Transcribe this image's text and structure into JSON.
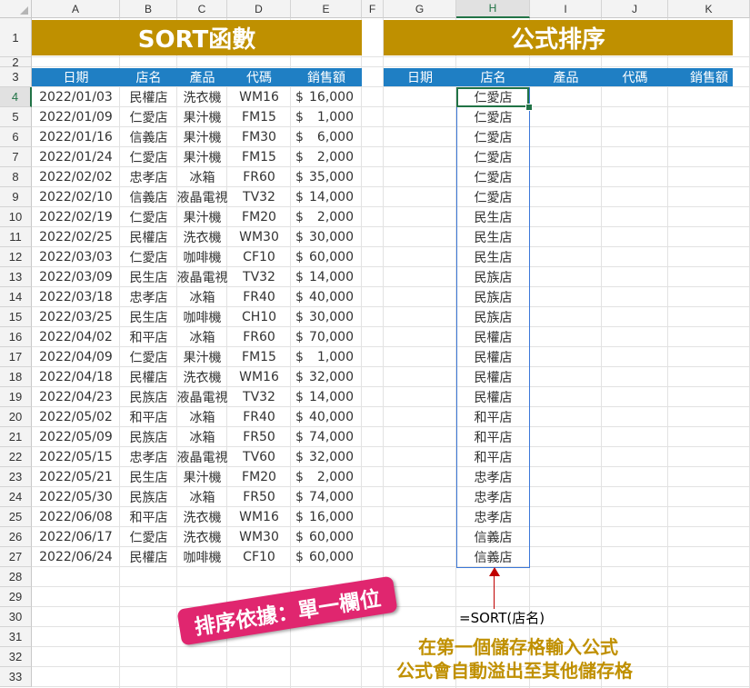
{
  "columns": [
    "A",
    "B",
    "C",
    "D",
    "E",
    "F",
    "G",
    "H",
    "I",
    "J",
    "K"
  ],
  "selected_column": "H",
  "rows": [
    1,
    2,
    3,
    4,
    5,
    6,
    7,
    8,
    9,
    10,
    11,
    12,
    13,
    14,
    15,
    16,
    17,
    18,
    19,
    20,
    21,
    22,
    23,
    24,
    25,
    26,
    27,
    28,
    29,
    30,
    31,
    32,
    33
  ],
  "selected_row": 4,
  "left_title": "SORT函數",
  "right_title": "公式排序",
  "left_headers": [
    "日期",
    "店名",
    "產品",
    "代碼",
    "銷售額"
  ],
  "right_headers": [
    "日期",
    "店名",
    "產品",
    "代碼",
    "銷售額"
  ],
  "currency_symbol": "$",
  "records": [
    [
      "2022/01/03",
      "民權店",
      "洗衣機",
      "WM16",
      "16,000"
    ],
    [
      "2022/01/09",
      "仁愛店",
      "果汁機",
      "FM15",
      "1,000"
    ],
    [
      "2022/01/16",
      "信義店",
      "果汁機",
      "FM30",
      "6,000"
    ],
    [
      "2022/01/24",
      "仁愛店",
      "果汁機",
      "FM15",
      "2,000"
    ],
    [
      "2022/02/02",
      "忠孝店",
      "冰箱",
      "FR60",
      "35,000"
    ],
    [
      "2022/02/10",
      "信義店",
      "液晶電視",
      "TV32",
      "14,000"
    ],
    [
      "2022/02/19",
      "仁愛店",
      "果汁機",
      "FM20",
      "2,000"
    ],
    [
      "2022/02/25",
      "民權店",
      "洗衣機",
      "WM30",
      "30,000"
    ],
    [
      "2022/03/03",
      "仁愛店",
      "咖啡機",
      "CF10",
      "60,000"
    ],
    [
      "2022/03/09",
      "民生店",
      "液晶電視",
      "TV32",
      "14,000"
    ],
    [
      "2022/03/18",
      "忠孝店",
      "冰箱",
      "FR40",
      "40,000"
    ],
    [
      "2022/03/25",
      "民生店",
      "咖啡機",
      "CH10",
      "30,000"
    ],
    [
      "2022/04/02",
      "和平店",
      "冰箱",
      "FR60",
      "70,000"
    ],
    [
      "2022/04/09",
      "仁愛店",
      "果汁機",
      "FM15",
      "1,000"
    ],
    [
      "2022/04/18",
      "民權店",
      "洗衣機",
      "WM16",
      "32,000"
    ],
    [
      "2022/04/23",
      "民族店",
      "液晶電視",
      "TV32",
      "14,000"
    ],
    [
      "2022/05/02",
      "和平店",
      "冰箱",
      "FR40",
      "40,000"
    ],
    [
      "2022/05/09",
      "民族店",
      "冰箱",
      "FR50",
      "74,000"
    ],
    [
      "2022/05/15",
      "忠孝店",
      "液晶電視",
      "TV60",
      "32,000"
    ],
    [
      "2022/05/21",
      "民生店",
      "果汁機",
      "FM20",
      "2,000"
    ],
    [
      "2022/05/30",
      "民族店",
      "冰箱",
      "FR50",
      "74,000"
    ],
    [
      "2022/06/08",
      "和平店",
      "洗衣機",
      "WM16",
      "16,000"
    ],
    [
      "2022/06/17",
      "仁愛店",
      "洗衣機",
      "WM30",
      "60,000"
    ],
    [
      "2022/06/24",
      "民權店",
      "咖啡機",
      "CF10",
      "60,000"
    ]
  ],
  "sorted_stores": [
    "仁愛店",
    "仁愛店",
    "仁愛店",
    "仁愛店",
    "仁愛店",
    "仁愛店",
    "民生店",
    "民生店",
    "民生店",
    "民族店",
    "民族店",
    "民族店",
    "民權店",
    "民權店",
    "民權店",
    "民權店",
    "和平店",
    "和平店",
    "和平店",
    "忠孝店",
    "忠孝店",
    "忠孝店",
    "信義店",
    "信義店"
  ],
  "formula_text": "=SORT(店名)",
  "note_line1": "在第一個儲存格輸入公式",
  "note_line2": "公式會自動溢出至其他儲存格",
  "badge_text": "排序依據：單一欄位",
  "colors": {
    "banner": "#bf9000",
    "header": "#1f7fc4",
    "badge": "#e0266f",
    "note": "#c09000",
    "arrow": "#c00000",
    "selection": "#217346",
    "spill_border": "#3c78d8"
  }
}
